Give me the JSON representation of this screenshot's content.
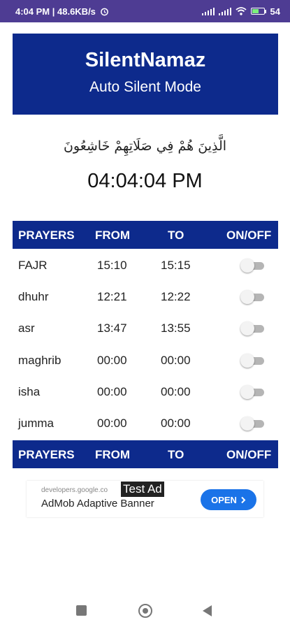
{
  "status_bar": {
    "time_speed": "4:04 PM | 48.6KB/s",
    "battery": "54"
  },
  "header": {
    "title": "SilentNamaz",
    "subtitle": "Auto Silent Mode"
  },
  "verse": "الَّذِينَ هُمْ فِي صَلَاتِهِمْ خَاشِعُونَ",
  "clock": "04:04:04 PM",
  "table": {
    "headers": [
      "PRAYERS",
      "FROM",
      "TO",
      "ON/OFF"
    ],
    "rows": [
      {
        "name": "FAJR",
        "from": "15:10",
        "to": "15:15",
        "enabled": false
      },
      {
        "name": "dhuhr",
        "from": "12:21",
        "to": "12:22",
        "enabled": false
      },
      {
        "name": "asr",
        "from": "13:47",
        "to": "13:55",
        "enabled": false
      },
      {
        "name": "maghrib",
        "from": "00:00",
        "to": "00:00",
        "enabled": false
      },
      {
        "name": "isha",
        "from": "00:00",
        "to": "00:00",
        "enabled": false
      },
      {
        "name": "jumma",
        "from": "00:00",
        "to": "00:00",
        "enabled": false
      }
    ]
  },
  "ad": {
    "source": "developers.google.co",
    "tag": "Test Ad",
    "headline": "AdMob Adaptive Banner",
    "cta": "OPEN"
  },
  "colors": {
    "header_bg": "#0d2a8c",
    "status_bar_bg": "#4e3c93",
    "cta_bg": "#1a73e8"
  },
  "icons": {
    "alarm": "alarm-icon",
    "signal": "signal-icon",
    "wifi": "wifi-icon",
    "battery": "battery-icon",
    "toggle": "toggle-switch",
    "nav_recents": "recents-icon",
    "nav_home": "home-icon",
    "nav_back": "back-icon"
  }
}
